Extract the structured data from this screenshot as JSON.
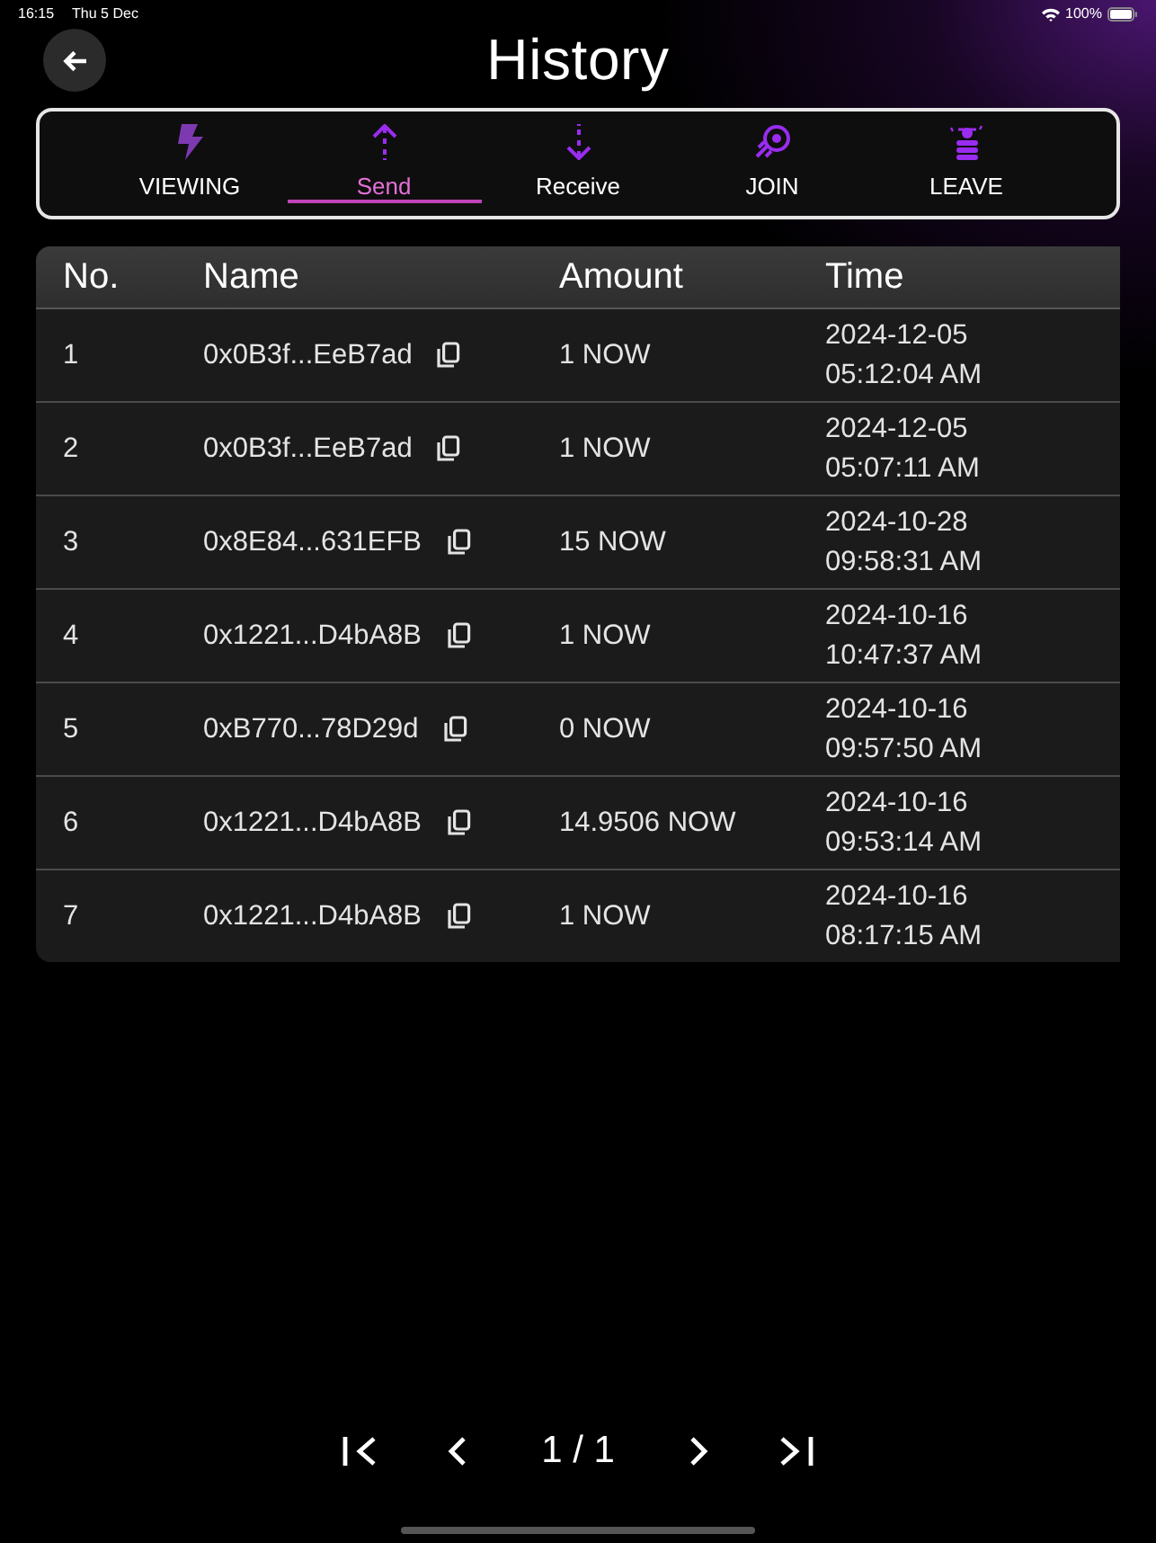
{
  "status_bar": {
    "time": "16:15",
    "date": "Thu 5 Dec",
    "battery": "100%"
  },
  "header": {
    "title": "History"
  },
  "tabs": [
    {
      "label": "VIEWING",
      "kind": "bolt",
      "selected": false
    },
    {
      "label": "Send",
      "kind": "up",
      "selected": true
    },
    {
      "label": "Receive",
      "kind": "down",
      "selected": false
    },
    {
      "label": "JOIN",
      "kind": "join",
      "selected": false
    },
    {
      "label": "LEAVE",
      "kind": "leave",
      "selected": false
    }
  ],
  "table": {
    "columns": [
      "No.",
      "Name",
      "Amount",
      "Time"
    ],
    "rows": [
      {
        "no": "1",
        "name": "0x0B3f...EeB7ad",
        "amount": "1 NOW",
        "time": "2024-12-05 05:12:04 AM"
      },
      {
        "no": "2",
        "name": "0x0B3f...EeB7ad",
        "amount": "1 NOW",
        "time": "2024-12-05 05:07:11 AM"
      },
      {
        "no": "3",
        "name": "0x8E84...631EFB",
        "amount": "15 NOW",
        "time": "2024-10-28 09:58:31 AM"
      },
      {
        "no": "4",
        "name": "0x1221...D4bA8B",
        "amount": "1 NOW",
        "time": "2024-10-16 10:47:37 AM"
      },
      {
        "no": "5",
        "name": "0xB770...78D29d",
        "amount": "0 NOW",
        "time": "2024-10-16 09:57:50 AM"
      },
      {
        "no": "6",
        "name": "0x1221...D4bA8B",
        "amount": "14.9506 NOW",
        "time": "2024-10-16 09:53:14 AM"
      },
      {
        "no": "7",
        "name": "0x1221...D4bA8B",
        "amount": "1 NOW",
        "time": "2024-10-16 08:17:15 AM"
      }
    ]
  },
  "pagination": {
    "page": "1 / 1"
  }
}
